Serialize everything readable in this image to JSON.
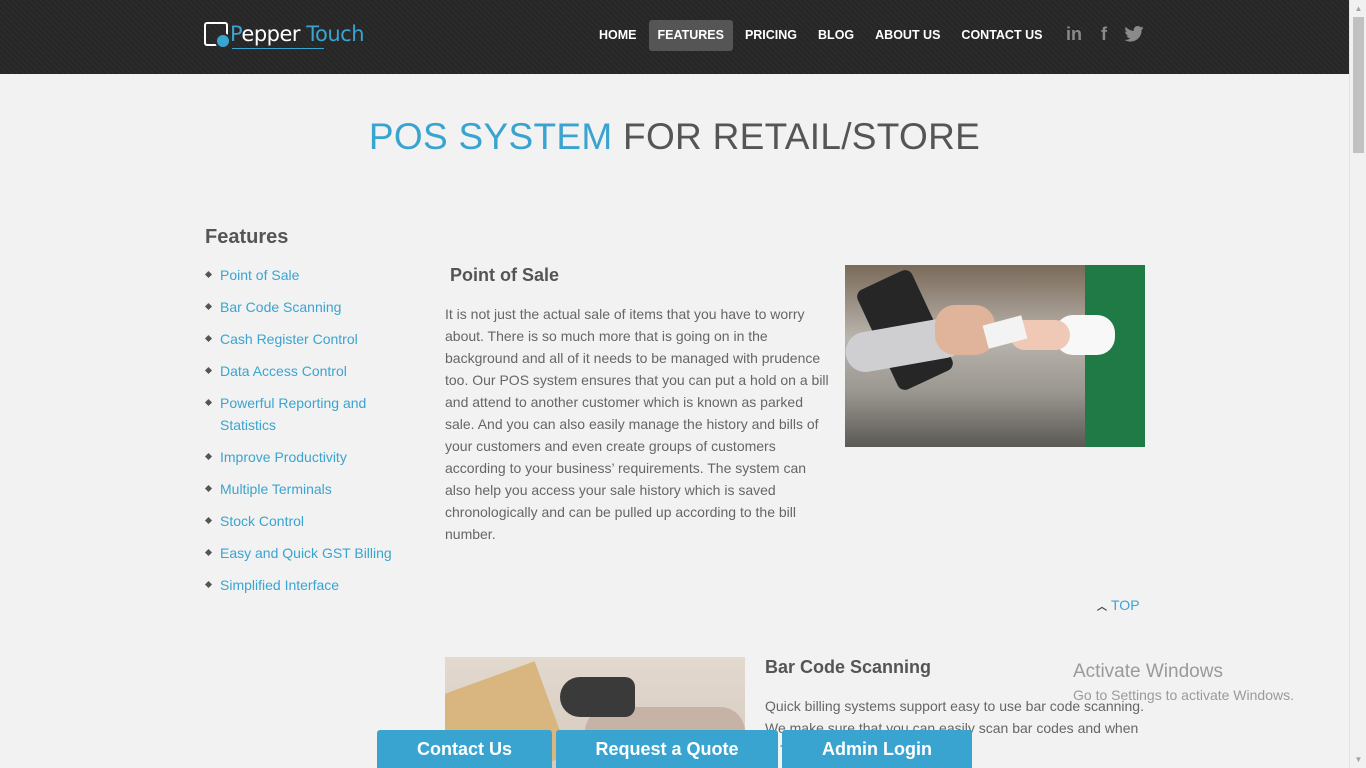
{
  "brand": {
    "logo_part1": "P",
    "logo_part1b": "epper",
    "logo_part2": "Touch"
  },
  "nav": {
    "items": [
      "HOME",
      "FEATURES",
      "PRICING",
      "BLOG",
      "ABOUT US",
      "CONTACT US"
    ],
    "active": "FEATURES"
  },
  "social": {
    "linkedin": "in",
    "facebook": "f",
    "twitter": "twitter-icon"
  },
  "title": {
    "highlight": "POS SYSTEM",
    "rest": " FOR RETAIL/STORE"
  },
  "sidebar": {
    "heading": "Features",
    "items": [
      "Point of Sale",
      "Bar Code Scanning",
      "Cash Register Control",
      "Data Access Control",
      "Powerful Reporting and Statistics",
      "Improve Productivity",
      "Multiple Terminals",
      "Stock Control",
      "Easy and Quick GST Billing",
      "Simplified Interface"
    ]
  },
  "section1": {
    "title": "Point of Sale",
    "text": "It is not just the actual sale of items that you have to worry about. There is so much more that is going on in the background and all of it needs to be managed with prudence too. Our POS system ensures that you can put a hold on a bill and attend to another customer which is known as parked sale. And you can also easily manage the history and bills of your customers and even create groups of customers according to your business’ requirements. The system can also help you access your sale history which is saved chronologically and can be pulled up according to the bill number."
  },
  "top_link": "TOP",
  "section2": {
    "title": "Bar Code Scanning",
    "text": "Quick billing systems support easy to use bar code scanning. We make sure that you can easily scan bar codes and when ... This makes the system"
  },
  "floating": {
    "contact": "Contact Us",
    "quote": "Request a Quote",
    "admin": "Admin Login"
  },
  "watermark": {
    "line1": "Activate Windows",
    "line2": "Go to Settings to activate Windows."
  },
  "colors": {
    "accent": "#3aa4d0",
    "header": "#2b2b2b",
    "text": "#555555"
  }
}
